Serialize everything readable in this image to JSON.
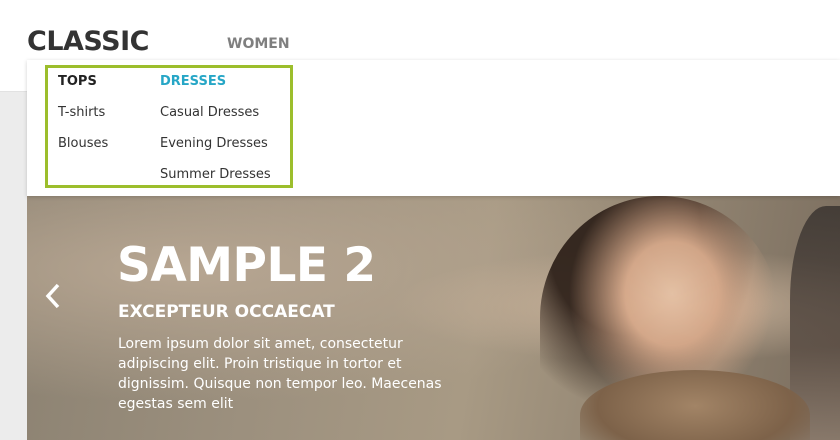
{
  "header": {
    "logo": "CLASSIC",
    "top_menu": {
      "label": "WOMEN"
    }
  },
  "dropdown": {
    "highlight_color": "#9cbe2c",
    "columns": [
      {
        "heading": "TOPS",
        "links": [
          "T-shirts",
          "Blouses"
        ]
      },
      {
        "heading": "DRESSES",
        "heading_color": "#26a6c6",
        "links": [
          "Casual Dresses",
          "Evening Dresses",
          "Summer Dresses"
        ]
      }
    ]
  },
  "slider": {
    "prev_icon": "chevron-left-icon",
    "title": "SAMPLE 2",
    "subtitle": "EXCEPTEUR OCCAECAT",
    "text": "Lorem ipsum dolor sit amet, consectetur adipiscing elit. Proin tristique in tortor et dignissim. Quisque non tempor leo. Maecenas egestas sem elit"
  }
}
